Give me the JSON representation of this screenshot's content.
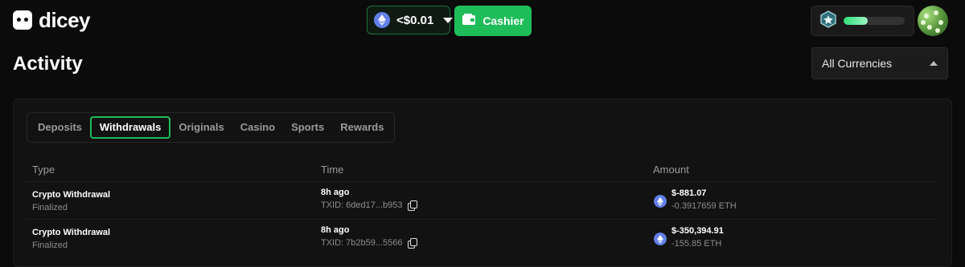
{
  "header": {
    "logo_text": "dicey",
    "balance": {
      "value": "<$0.01",
      "currency_icon": "eth-icon"
    },
    "cashier_label": "Cashier",
    "level_progress": 0.4
  },
  "page": {
    "title": "Activity",
    "currency_filter": "All Currencies"
  },
  "tabs": [
    {
      "label": "Deposits",
      "active": false
    },
    {
      "label": "Withdrawals",
      "active": true
    },
    {
      "label": "Originals",
      "active": false
    },
    {
      "label": "Casino",
      "active": false
    },
    {
      "label": "Sports",
      "active": false
    },
    {
      "label": "Rewards",
      "active": false
    }
  ],
  "table": {
    "columns": [
      "Type",
      "Time",
      "Amount"
    ],
    "rows": [
      {
        "type": "Crypto Withdrawal",
        "status": "Finalized",
        "time": "8h ago",
        "txid": "TXID: 6ded17...b953",
        "amount_usd": "$-881.07",
        "amount_crypto": "-0.3917659 ETH"
      },
      {
        "type": "Crypto Withdrawal",
        "status": "Finalized",
        "time": "8h ago",
        "txid": "TXID: 7b2b59...5566",
        "amount_usd": "$-350,394.91",
        "amount_crypto": "-155.85 ETH"
      }
    ]
  },
  "colors": {
    "accent": "#1ebd5a",
    "eth": "#627eea",
    "background": "#0b0b0b"
  }
}
